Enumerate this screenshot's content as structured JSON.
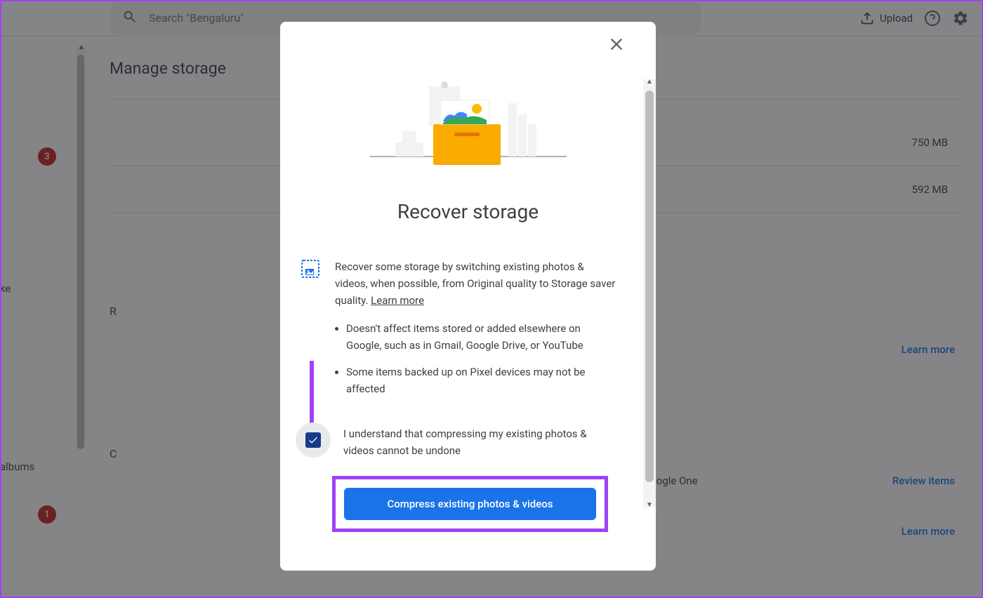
{
  "header": {
    "search_placeholder": "Search \"Bengaluru\"",
    "upload_label": "Upload"
  },
  "sidebar": {
    "badge_top": "3",
    "text_ke": "ke",
    "text_albums": "albums",
    "badge_bottom": "1"
  },
  "page": {
    "title": "Manage storage",
    "storage_rows": [
      {
        "value": "750 MB"
      },
      {
        "value": "592 MB"
      }
    ],
    "section_r": "R",
    "section_c": "C",
    "learn_more": "Learn more",
    "review_items": "Review items",
    "google_one": "Google One"
  },
  "modal": {
    "title": "Recover storage",
    "description": "Recover some storage by switching existing photos & videos, when possible, from Original quality to Storage saver quality. ",
    "learn_more": "Learn more",
    "bullets": [
      "Doesn't affect items stored or added elsewhere on Google, such as in Gmail, Google Drive, or YouTube",
      "Some items backed up on Pixel devices may not be affected"
    ],
    "checkbox_label": "I understand that compressing my existing photos & videos cannot be undone",
    "checkbox_checked": true,
    "action_button": "Compress existing photos & videos"
  }
}
